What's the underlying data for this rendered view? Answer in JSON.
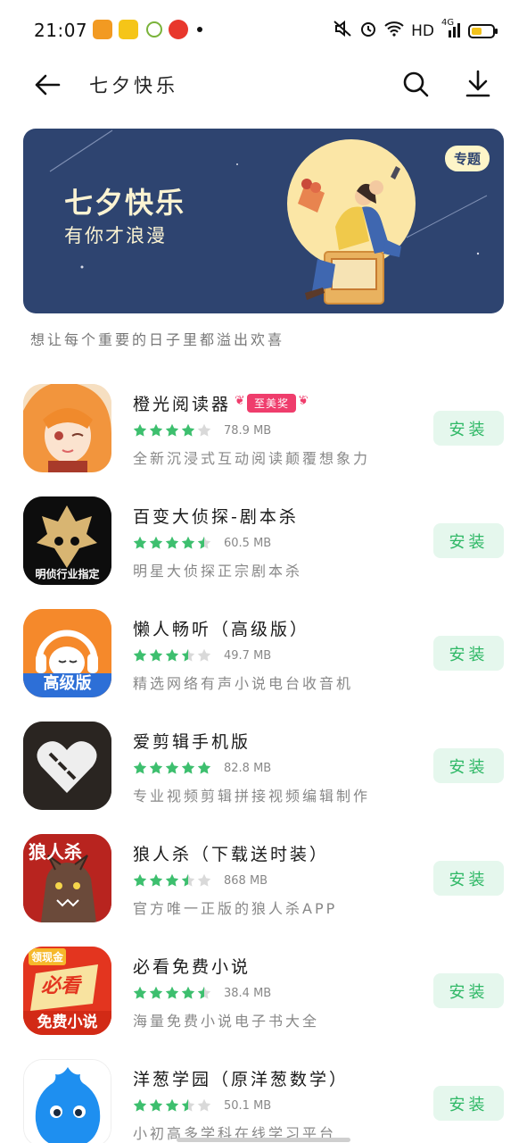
{
  "status_bar": {
    "time": "21:07",
    "network": "HD",
    "signal": "4G"
  },
  "header": {
    "title": "七夕快乐",
    "back_icon": "arrow-left-icon",
    "search_icon": "search-icon",
    "download_icon": "download-icon"
  },
  "banner": {
    "title": "七夕快乐",
    "subtitle": "有你才浪漫",
    "tag": "专题",
    "caption": "想让每个重要的日子里都溢出欢喜"
  },
  "apps": [
    {
      "name": "橙光阅读器",
      "badge": "至美奖",
      "rating": 4,
      "size": "78.9 MB",
      "desc": "全新沉浸式互动阅读颠覆想象力",
      "button": "安装"
    },
    {
      "name": "百变大侦探-剧本杀",
      "badge": "",
      "rating": 4.5,
      "size": "60.5 MB",
      "desc": "明星大侦探正宗剧本杀",
      "button": "安装"
    },
    {
      "name": "懒人畅听（高级版）",
      "badge": "",
      "rating": 3.5,
      "size": "49.7 MB",
      "desc": "精选网络有声小说电台收音机",
      "button": "安装"
    },
    {
      "name": "爱剪辑手机版",
      "badge": "",
      "rating": 5,
      "size": "82.8 MB",
      "desc": "专业视频剪辑拼接视频编辑制作",
      "button": "安装"
    },
    {
      "name": "狼人杀（下载送时装）",
      "badge": "",
      "rating": 3.5,
      "size": "868 MB",
      "desc": "官方唯一正版的狼人杀APP",
      "button": "安装"
    },
    {
      "name": "必看免费小说",
      "badge": "",
      "rating": 4.5,
      "size": "38.4 MB",
      "desc": "海量免费小说电子书大全",
      "button": "安装"
    },
    {
      "name": "洋葱学园（原洋葱数学）",
      "badge": "",
      "rating": 3.5,
      "size": "50.1 MB",
      "desc": "小初高多学科在线学习平台",
      "button": "安装"
    }
  ],
  "icon_texts": {
    "app2": "明侦行业指定",
    "app3": "高级版",
    "app5": "狼人杀",
    "app6_top": "领现金",
    "app6_mid": "必看",
    "app6_bottom": "免费小说"
  },
  "colors": {
    "accent_green": "#2fb866",
    "install_bg": "#e5f7ed",
    "star_green": "#3dbf6e",
    "banner_bg": "#2e4470",
    "badge_pink": "#ef3d6c"
  }
}
